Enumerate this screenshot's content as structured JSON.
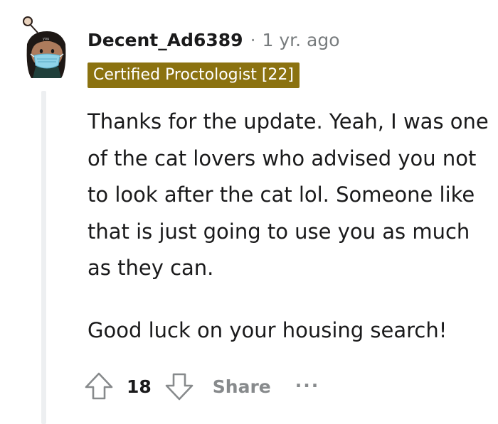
{
  "comment": {
    "author": "Decent_Ad6389",
    "separator": "·",
    "timestamp": "1 yr. ago",
    "flair": "Certified Proctologist [22]",
    "paragraphs": [
      "Thanks for the update. Yeah, I was one of the cat lovers who advised you not to look after the cat lol. Someone like that is just going to use you as much as they can.",
      "Good luck on your housing search!"
    ]
  },
  "actions": {
    "score": "18",
    "share_label": "Share",
    "more_label": "..."
  },
  "colors": {
    "flair_background": "#8b7210",
    "flair_text": "#ffffff",
    "meta_text": "#787c7e",
    "muted_action": "#878a8c",
    "thread_line": "#edeff1"
  },
  "icons": {
    "avatar": "snoo-avatar-with-face-mask",
    "upvote": "upvote-arrow-icon",
    "downvote": "downvote-arrow-icon",
    "more": "more-options-icon"
  }
}
